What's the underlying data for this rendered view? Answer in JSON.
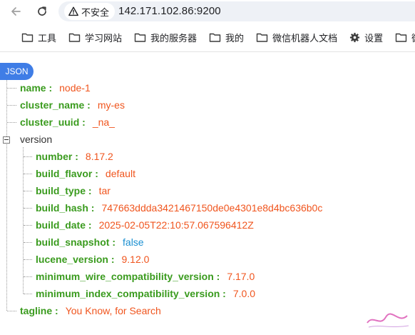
{
  "toolbar": {
    "security_label": "不安全",
    "url": "142.171.102.86:9200"
  },
  "bookmarks": [
    {
      "label": "工具",
      "icon": "folder-icon"
    },
    {
      "label": "学习网站",
      "icon": "folder-icon"
    },
    {
      "label": "我的服务器",
      "icon": "folder-icon"
    },
    {
      "label": "我的",
      "icon": "folder-icon"
    },
    {
      "label": "微信机器人文档",
      "icon": "folder-icon"
    },
    {
      "label": "设置",
      "icon": "gear-icon"
    },
    {
      "label": "微信",
      "icon": "folder-icon"
    }
  ],
  "json_view": {
    "badge": "JSON",
    "root": {
      "name": {
        "key": "name",
        "value": "node-1"
      },
      "cluster_name": {
        "key": "cluster_name",
        "value": "my-es"
      },
      "cluster_uuid": {
        "key": "cluster_uuid",
        "value": "_na_"
      },
      "version_key": "version",
      "version": {
        "number": {
          "key": "number",
          "value": "8.17.2"
        },
        "build_flavor": {
          "key": "build_flavor",
          "value": "default"
        },
        "build_type": {
          "key": "build_type",
          "value": "tar"
        },
        "build_hash": {
          "key": "build_hash",
          "value": "747663ddda3421467150de0e4301e8d4bc636b0c"
        },
        "build_date": {
          "key": "build_date",
          "value": "2025-02-05T22:10:57.067596412Z"
        },
        "build_snapshot": {
          "key": "build_snapshot",
          "value": "false"
        },
        "lucene_version": {
          "key": "lucene_version",
          "value": "9.12.0"
        },
        "minimum_wire_compatibility_version": {
          "key": "minimum_wire_compatibility_version",
          "value": "7.17.0"
        },
        "minimum_index_compatibility_version": {
          "key": "minimum_index_compatibility_version",
          "value": "7.0.0"
        }
      },
      "tagline": {
        "key": "tagline",
        "value": "You Know, for Search"
      }
    }
  },
  "colors": {
    "key": "#3a9b1e",
    "string_value": "#f0551e",
    "boolean_value": "#1a8fd1",
    "badge": "#3f7de6"
  }
}
